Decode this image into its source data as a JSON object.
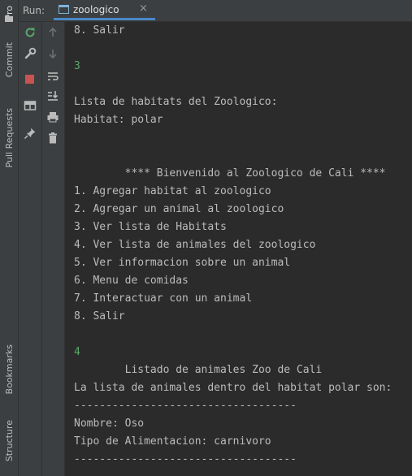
{
  "sidebar": {
    "project_label": "Pro",
    "commit_label": "Commit",
    "pull_requests_label": "Pull Requests",
    "bookmarks_label": "Bookmarks",
    "structure_label": "Structure"
  },
  "run_bar": {
    "label": "Run:",
    "tab_label": "zoologico",
    "tab_close": "×"
  },
  "colors": {
    "background": "#2b2b2b",
    "panel": "#3c3f41",
    "text": "#bbbbbb",
    "user_input": "#59a869",
    "tab_underline": "#4a88c7",
    "stop": "#c75450",
    "rerun": "#59a869"
  },
  "console": {
    "lines": [
      {
        "text": "8. Salir",
        "type": "output"
      },
      {
        "text": "",
        "type": "output"
      },
      {
        "text": "3",
        "type": "input"
      },
      {
        "text": "",
        "type": "output"
      },
      {
        "text": "Lista de habitats del Zoologico:",
        "type": "output"
      },
      {
        "text": "Habitat: polar",
        "type": "output"
      },
      {
        "text": "",
        "type": "output"
      },
      {
        "text": "",
        "type": "output"
      },
      {
        "text": "        **** Bienvenido al Zoologico de Cali ****",
        "type": "output"
      },
      {
        "text": "1. Agregar habitat al zoologico",
        "type": "output"
      },
      {
        "text": "2. Agregar un animal al zoologico",
        "type": "output"
      },
      {
        "text": "3. Ver lista de Habitats",
        "type": "output"
      },
      {
        "text": "4. Ver lista de animales del zoologico",
        "type": "output"
      },
      {
        "text": "5. Ver informacion sobre un animal",
        "type": "output"
      },
      {
        "text": "6. Menu de comidas",
        "type": "output"
      },
      {
        "text": "7. Interactuar con un animal",
        "type": "output"
      },
      {
        "text": "8. Salir",
        "type": "output"
      },
      {
        "text": "",
        "type": "output"
      },
      {
        "text": "4",
        "type": "input"
      },
      {
        "text": "        Listado de animales Zoo de Cali",
        "type": "output"
      },
      {
        "text": "La lista de animales dentro del habitat polar son:",
        "type": "output"
      },
      {
        "text": "-----------------------------------",
        "type": "output"
      },
      {
        "text": "Nombre: Oso",
        "type": "output"
      },
      {
        "text": "Tipo de Alimentacion: carnivoro",
        "type": "output"
      },
      {
        "text": "-----------------------------------",
        "type": "output"
      }
    ]
  },
  "icons": {
    "rerun": "rerun-icon",
    "wrench": "wrench-icon",
    "stop": "stop-icon",
    "layout": "layout-icon",
    "pin": "pin-icon",
    "up": "arrow-up-icon",
    "down": "arrow-down-icon",
    "soft_wrap": "soft-wrap-icon",
    "scroll_end": "scroll-to-end-icon",
    "print": "print-icon",
    "trash": "trash-icon"
  }
}
